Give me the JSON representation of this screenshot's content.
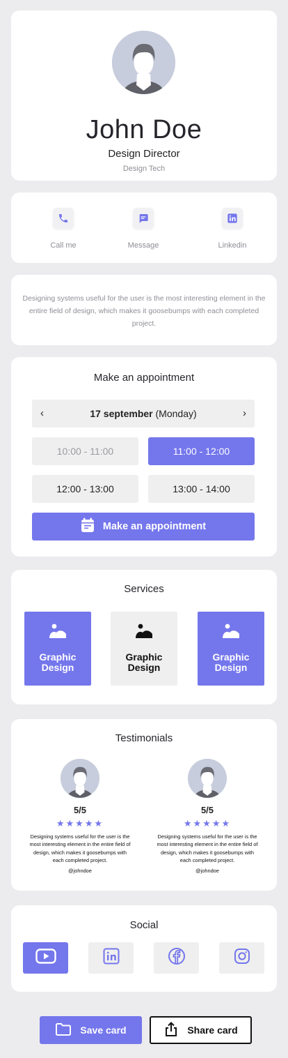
{
  "profile": {
    "name": "John Doe",
    "title": "Design Director",
    "company": "Design Tech"
  },
  "contacts": [
    {
      "label": "Call me",
      "icon": "phone-icon"
    },
    {
      "label": "Message",
      "icon": "message-icon"
    },
    {
      "label": "Linkedin",
      "icon": "linkedin-icon"
    }
  ],
  "bio": "Designing systems useful for the user is the most interesting element in the entire field of design, which makes it goosebumps with each completed project.",
  "appointment": {
    "title": "Make an appointment",
    "date": "17 september",
    "weekday": "(Monday)",
    "prev": "‹",
    "next": "›",
    "slots": [
      {
        "label": "10:00 - 11:00",
        "state": "disabled"
      },
      {
        "label": "11:00 - 12:00",
        "state": "selected"
      },
      {
        "label": "12:00 - 13:00",
        "state": "available"
      },
      {
        "label": "13:00 - 14:00",
        "state": "available"
      }
    ],
    "button": "Make an appointment"
  },
  "services": {
    "title": "Services",
    "items": [
      {
        "label_line1": "Graphic",
        "label_line2": "Design",
        "style": "filled"
      },
      {
        "label_line1": "Graphic",
        "label_line2": "Design",
        "style": "plain"
      },
      {
        "label_line1": "Graphic",
        "label_line2": "Design",
        "style": "filled"
      }
    ]
  },
  "testimonials": {
    "title": "Testimonials",
    "items": [
      {
        "rating": "5/5",
        "stars": "★★★★★",
        "text": "Designing systems useful for the user is the most interesting element in the entire field of design, which makes it goosebumps with each completed project.",
        "handle": "@johndoe"
      },
      {
        "rating": "5/5",
        "stars": "★★★★★",
        "text": "Designing systems useful for the user is the most interesting element in the entire field of design, which makes it goosebumps with each completed project.",
        "handle": "@johndoe"
      }
    ]
  },
  "social": {
    "title": "Social",
    "items": [
      "youtube-icon",
      "linkedin-icon",
      "facebook-icon",
      "instagram-icon"
    ]
  },
  "actions": {
    "save": "Save card",
    "share": "Share card"
  },
  "colors": {
    "accent": "#7476EC",
    "background": "#ECECEE",
    "tile": "#EFEFEF"
  }
}
